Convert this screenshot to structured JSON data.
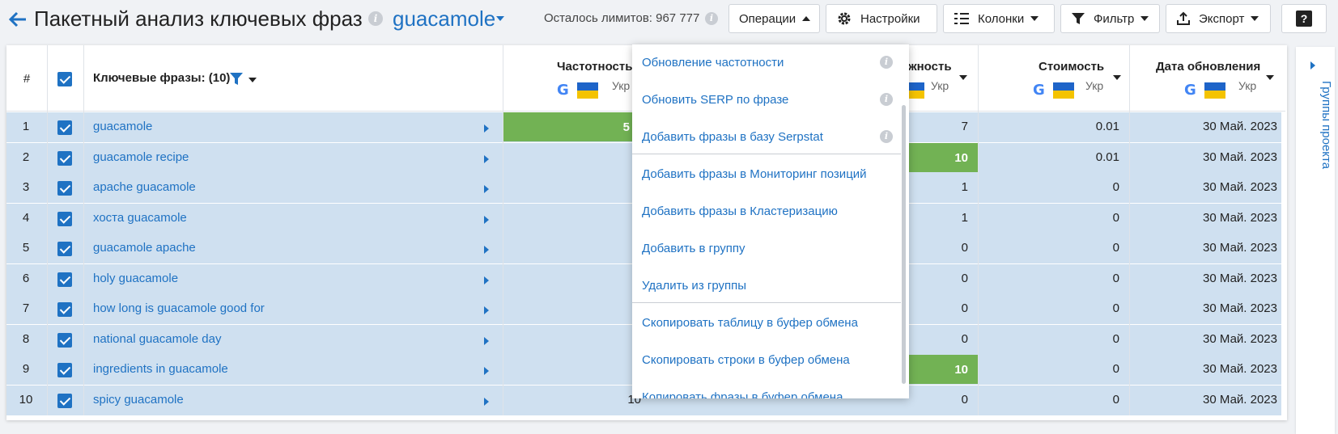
{
  "header": {
    "title": "Пакетный анализ ключевых фраз",
    "project": "guacamole",
    "limits": "Осталось лимитов: 967 777"
  },
  "toolbar": {
    "operations": "Операции",
    "settings": "Настройки",
    "columns": "Колонки",
    "filter": "Фильтр",
    "export": "Экспорт",
    "help": "?"
  },
  "table": {
    "headers": {
      "num": "#",
      "keywords": "Ключевые фразы: (10)",
      "frequency": "Частотность",
      "difficulty": "ожность",
      "cost": "Стоимость",
      "updated": "Дата обновления",
      "region": "Укр"
    },
    "rows": [
      {
        "num": "1",
        "keyword": "guacamole",
        "freq": "5",
        "difficulty": "7",
        "cost": "0.01",
        "date": "30 Май. 2023"
      },
      {
        "num": "2",
        "keyword": "guacamole recipe",
        "freq": "",
        "difficulty": "10",
        "cost": "0.01",
        "date": "30 Май. 2023"
      },
      {
        "num": "3",
        "keyword": "apache guacamole",
        "freq": "",
        "difficulty": "1",
        "cost": "0",
        "date": "30 Май. 2023"
      },
      {
        "num": "4",
        "keyword": "хоста guacamole",
        "freq": "",
        "difficulty": "1",
        "cost": "0",
        "date": "30 Май. 2023"
      },
      {
        "num": "5",
        "keyword": "guacamole apache",
        "freq": "",
        "difficulty": "0",
        "cost": "0",
        "date": "30 Май. 2023"
      },
      {
        "num": "6",
        "keyword": "holy guacamole",
        "freq": "",
        "difficulty": "0",
        "cost": "0",
        "date": "30 Май. 2023"
      },
      {
        "num": "7",
        "keyword": "how long is guacamole good for",
        "freq": "",
        "difficulty": "0",
        "cost": "0",
        "date": "30 Май. 2023"
      },
      {
        "num": "8",
        "keyword": "national guacamole day",
        "freq": "",
        "difficulty": "0",
        "cost": "0",
        "date": "30 Май. 2023"
      },
      {
        "num": "9",
        "keyword": "ingredients in guacamole",
        "freq": "",
        "difficulty": "10",
        "cost": "0",
        "date": "30 Май. 2023"
      },
      {
        "num": "10",
        "keyword": "spicy guacamole",
        "freq": "10",
        "difficulty": "0",
        "cost": "0",
        "date": "30 Май. 2023"
      }
    ]
  },
  "dropdown": {
    "items": [
      "Обновление частотности",
      "Обновить SERP по фразе",
      "Добавить фразы в базу Serpstat",
      "Добавить фразы в Мониторинг позиций",
      "Добавить фразы в Кластеризацию",
      "Добавить в группу",
      "Удалить из группы",
      "Скопировать таблицу в буфер обмена",
      "Скопировать строки в буфер обмена",
      "Копировать фразы в буфер обмена"
    ]
  },
  "side_panel": {
    "label": "Группы проекта"
  },
  "colors": {
    "accent": "#1f72c3",
    "selected_row": "#cfe0f0",
    "green": "#72b254"
  }
}
